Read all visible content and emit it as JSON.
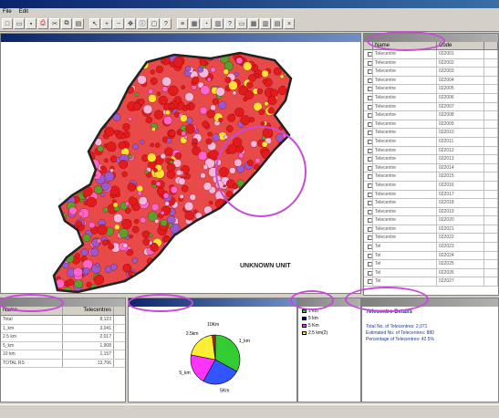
{
  "app": {
    "title": ""
  },
  "menu": [
    "File",
    "Edit"
  ],
  "toolbar": {
    "icons": [
      "new-icon",
      "open-icon",
      "save-icon",
      "print-icon",
      "cut-icon",
      "copy-icon",
      "paste-icon",
      "pointer-icon",
      "zoom-in-icon",
      "zoom-out-icon",
      "pan-icon",
      "identify-icon",
      "select-icon",
      "query-icon",
      "layer-icon",
      "legend-icon",
      "chart-icon",
      "table-icon",
      "help-icon",
      "window-icon",
      "grid-icon",
      "tile-icon",
      "cascade-icon",
      "close-icon"
    ]
  },
  "map": {
    "title": "",
    "label": "UNKNOWN UNIT",
    "colors": {
      "red": "#e31a1c",
      "magenta": "#ff66cc",
      "purple": "#9b59d0",
      "green": "#5aa02c",
      "yellow": "#ffe033",
      "pink": "#f7b8e0",
      "border": "#222222"
    }
  },
  "table": {
    "title": "",
    "columns": [
      "",
      "Name",
      "Code",
      ""
    ],
    "rows": [
      [
        "Telecentre",
        "022001"
      ],
      [
        "Telecentre",
        "022002"
      ],
      [
        "Telecentre",
        "022003"
      ],
      [
        "Telecentre",
        "022004"
      ],
      [
        "Telecentre",
        "022005"
      ],
      [
        "Telecentre",
        "022006"
      ],
      [
        "Telecentre",
        "022007"
      ],
      [
        "Telecentre",
        "022008"
      ],
      [
        "Telecentre",
        "022009"
      ],
      [
        "Telecentre",
        "022010"
      ],
      [
        "Telecentre",
        "022011"
      ],
      [
        "Telecentre",
        "022012"
      ],
      [
        "Telecentre",
        "022013"
      ],
      [
        "Telecentre",
        "022014"
      ],
      [
        "Telecentre",
        "022015"
      ],
      [
        "Telecentre",
        "022016"
      ],
      [
        "Telecentre",
        "022017"
      ],
      [
        "Telecentre",
        "022018"
      ],
      [
        "Telecentre",
        "022019"
      ],
      [
        "Telecentre",
        "022020"
      ],
      [
        "Telecentre",
        "022021"
      ],
      [
        "Telecentre",
        "022022"
      ],
      [
        "Tel",
        "022023"
      ],
      [
        "Tel",
        "022024"
      ],
      [
        "Tel",
        "022025"
      ],
      [
        "Tel",
        "022026"
      ],
      [
        "Tel",
        "022027"
      ]
    ]
  },
  "stats": {
    "title": "",
    "columns": [
      "Name",
      "Telecentres"
    ],
    "rows": [
      [
        "Total",
        "8,123"
      ],
      [
        "1_km",
        "3,041"
      ],
      [
        "2.5 km",
        "2,017"
      ],
      [
        "5_km",
        "1,908"
      ],
      [
        "10 km",
        "1,157"
      ],
      [
        "TOTAL RS",
        "13,706"
      ]
    ]
  },
  "chart_data": {
    "type": "pie",
    "title": "",
    "slices": [
      {
        "label": "1_km",
        "value": 33,
        "color": "#33cc33"
      },
      {
        "label": "5Km",
        "value": 25,
        "color": "#3355ff"
      },
      {
        "label": "5_km",
        "value": 20,
        "color": "#ff33ff"
      },
      {
        "label": "2.5km",
        "value": 20,
        "color": "#ffee33"
      },
      {
        "label": "10Km",
        "value": 2,
        "color": "#cc2222"
      }
    ]
  },
  "legend": {
    "title": "",
    "items": [
      {
        "label": "1 km",
        "color": "#33cc33"
      },
      {
        "label": "5 km",
        "color": "#000080"
      },
      {
        "label": "5 Km",
        "color": "#ff33ff"
      },
      {
        "label": "2.5 km(2)",
        "color": "#ffee33"
      }
    ]
  },
  "info": {
    "title": "",
    "heading": "Telecentre Details",
    "lines": [
      "Total No. of Telecentres: 2,071",
      "Estimated No. of Telecentres: 880",
      "Percentage of Telecentres: 42.5%"
    ]
  }
}
